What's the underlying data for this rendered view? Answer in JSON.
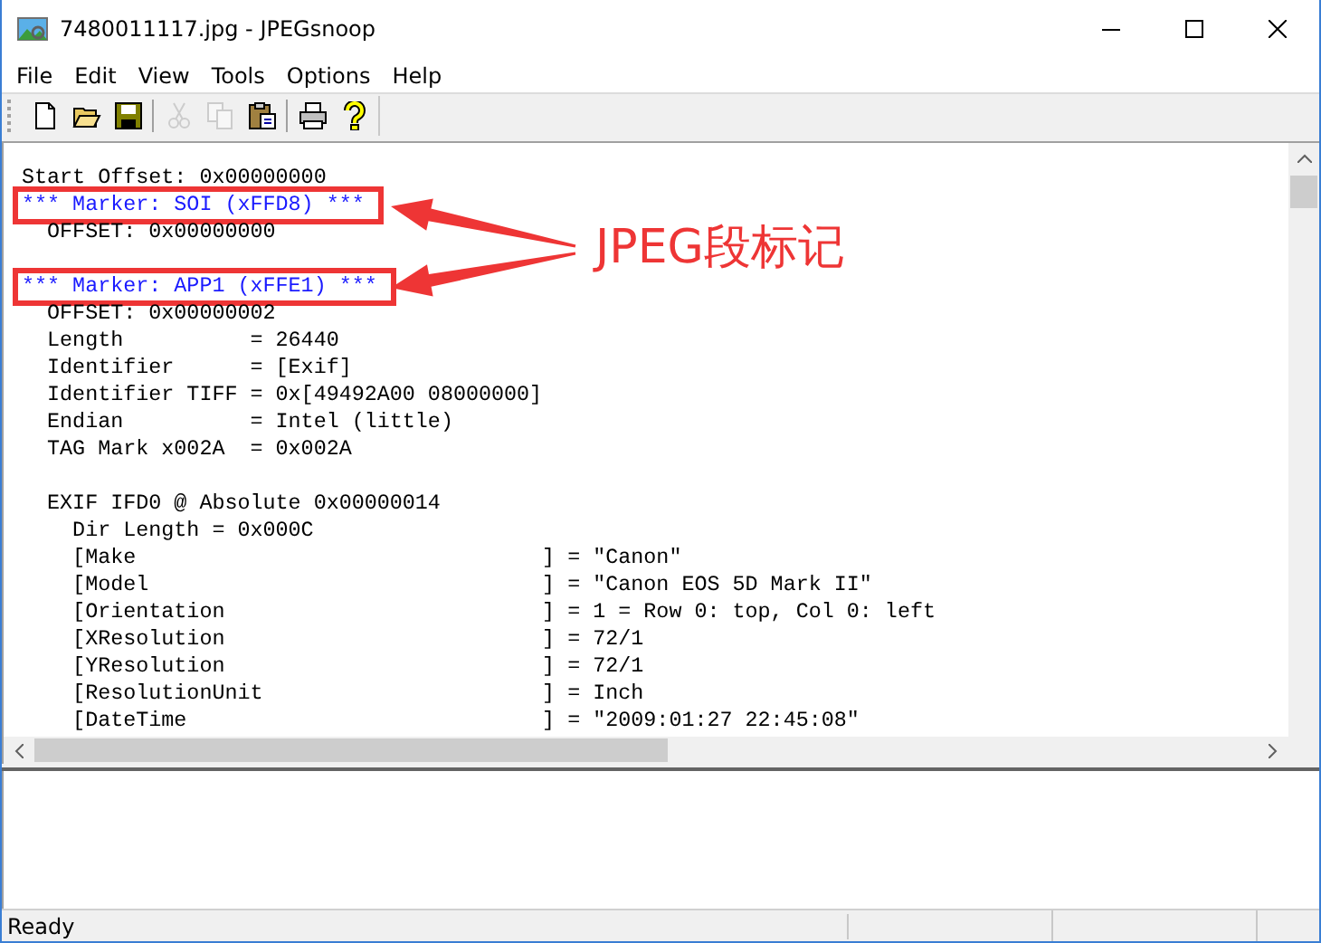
{
  "window": {
    "title": "7480011117.jpg - JPEGsnoop"
  },
  "menu": [
    "File",
    "Edit",
    "View",
    "Tools",
    "Options",
    "Help"
  ],
  "toolbar": [
    {
      "kind": "new",
      "disabled": false
    },
    {
      "kind": "open",
      "disabled": false
    },
    {
      "kind": "save",
      "disabled": false
    },
    {
      "kind": "separator"
    },
    {
      "kind": "cut",
      "disabled": true
    },
    {
      "kind": "copy",
      "disabled": true
    },
    {
      "kind": "paste",
      "disabled": false
    },
    {
      "kind": "separator"
    },
    {
      "kind": "print",
      "disabled": false
    },
    {
      "kind": "help",
      "disabled": false
    }
  ],
  "log": {
    "lines": [
      {
        "kind": "text",
        "text": "Start Offset: 0x00000000",
        "highlighted": false
      },
      {
        "kind": "marker",
        "text": "*** Marker: SOI (xFFD8) ***",
        "highlighted": true
      },
      {
        "kind": "text",
        "text": "  OFFSET: 0x00000000",
        "highlighted": false
      },
      {
        "kind": "blank"
      },
      {
        "kind": "marker",
        "text": "*** Marker: APP1 (xFFE1) ***",
        "highlighted": true
      },
      {
        "kind": "text",
        "text": "  OFFSET: 0x00000002",
        "highlighted": false
      },
      {
        "kind": "text",
        "text": "  Length          = 26440",
        "highlighted": false
      },
      {
        "kind": "text",
        "text": "  Identifier      = [Exif]",
        "highlighted": false
      },
      {
        "kind": "text",
        "text": "  Identifier TIFF = 0x[49492A00 08000000]",
        "highlighted": false
      },
      {
        "kind": "text",
        "text": "  Endian          = Intel (little)",
        "highlighted": false
      },
      {
        "kind": "text",
        "text": "  TAG Mark x002A  = 0x002A",
        "highlighted": false
      },
      {
        "kind": "blank"
      },
      {
        "kind": "text",
        "text": "  EXIF IFD0 @ Absolute 0x00000014",
        "highlighted": false
      },
      {
        "kind": "text",
        "text": "    Dir Length = 0x000C",
        "highlighted": false
      },
      {
        "kind": "text",
        "text": "    [Make                                ] = \"Canon\"",
        "highlighted": false
      },
      {
        "kind": "text",
        "text": "    [Model                               ] = \"Canon EOS 5D Mark II\"",
        "highlighted": false
      },
      {
        "kind": "text",
        "text": "    [Orientation                         ] = 1 = Row 0: top, Col 0: left",
        "highlighted": false
      },
      {
        "kind": "text",
        "text": "    [XResolution                         ] = 72/1",
        "highlighted": false
      },
      {
        "kind": "text",
        "text": "    [YResolution                         ] = 72/1",
        "highlighted": false
      },
      {
        "kind": "text",
        "text": "    [ResolutionUnit                      ] = Inch",
        "highlighted": false
      },
      {
        "kind": "text",
        "text": "    [DateTime                            ] = \"2009:01:27 22:45:08\"",
        "highlighted": false
      }
    ]
  },
  "annotation": {
    "label": "JPEG段标记"
  },
  "status_bar": {
    "text": "Ready"
  }
}
